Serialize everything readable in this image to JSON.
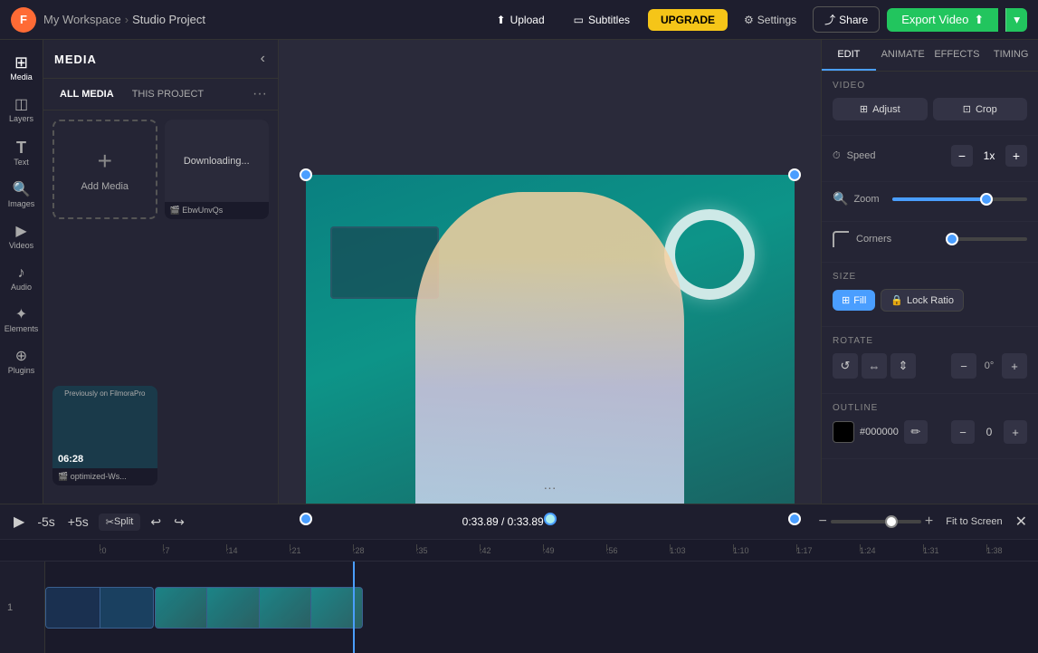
{
  "topbar": {
    "logo_text": "F",
    "workspace": "My Workspace",
    "arrow": "›",
    "project": "Studio Project",
    "upload_label": "Upload",
    "subtitles_label": "Subtitles",
    "upgrade_label": "UPGRADE",
    "settings_label": "Settings",
    "share_label": "Share",
    "export_label": "Export Video",
    "export_arrow": "▾"
  },
  "left_sidebar": {
    "items": [
      {
        "id": "media",
        "icon": "⊞",
        "label": "Media",
        "active": true
      },
      {
        "id": "layers",
        "icon": "◫",
        "label": "Layers"
      },
      {
        "id": "text",
        "icon": "T",
        "label": "Text"
      },
      {
        "id": "images",
        "icon": "🔍",
        "label": "Images"
      },
      {
        "id": "videos",
        "icon": "▶",
        "label": "Videos"
      },
      {
        "id": "audio",
        "icon": "♪",
        "label": "Audio"
      },
      {
        "id": "elements",
        "icon": "✦",
        "label": "Elements"
      },
      {
        "id": "plugins",
        "icon": "⊕",
        "label": "Plugins"
      }
    ]
  },
  "media_panel": {
    "title": "MEDIA",
    "tabs": [
      {
        "id": "all",
        "label": "ALL MEDIA",
        "active": true
      },
      {
        "id": "project",
        "label": "THIS PROJECT"
      }
    ],
    "add_media_label": "Add Media",
    "items": [
      {
        "id": "downloading",
        "name": "EbwUnvQs",
        "status": "Downloading..."
      },
      {
        "id": "video1",
        "name": "optimized-Ws...",
        "duration": "06:28",
        "badge": "Previously on FilmoraPro"
      }
    ]
  },
  "canvas": {
    "time_display": "0:33.89 / 0:33.89"
  },
  "right_panel": {
    "tabs": [
      "EDIT",
      "ANIMATE",
      "EFFECTS",
      "TIMING"
    ],
    "active_tab": "EDIT",
    "video_section": {
      "title": "VIDEO",
      "adjust_label": "Adjust",
      "crop_label": "Crop"
    },
    "speed": {
      "label": "Speed",
      "value": "1x",
      "minus": "−",
      "plus": "+"
    },
    "zoom": {
      "label": "Zoom",
      "value": 70
    },
    "corners": {
      "label": "Corners",
      "value": 0
    },
    "size": {
      "title": "SIZE",
      "fill_label": "Fill",
      "lock_label": "Lock Ratio"
    },
    "rotate": {
      "title": "ROTATE",
      "degree": "0°"
    },
    "outline": {
      "title": "OUTLINE",
      "color": "#000000",
      "hex_label": "#000000",
      "value": "0"
    }
  },
  "timeline": {
    "time": "0:33.89 / 0:33.89",
    "ruler_marks": [
      ":0",
      ":7",
      ":14",
      ":21",
      ":28",
      ":35",
      ":42",
      ":49",
      ":56",
      "1:03",
      "1:10",
      "1:17",
      "1:24",
      "1:31",
      "1:38"
    ],
    "fit_label": "Fit to Screen",
    "track_number": "1",
    "controls": {
      "rewind_label": "-5s",
      "forward_label": "+5s",
      "split_label": "Split",
      "undo_label": "↩",
      "redo_label": "↪"
    }
  },
  "colors": {
    "accent_blue": "#4a9eff",
    "accent_green": "#22c55e",
    "upgrade_yellow": "#f5c518",
    "panel_bg": "#252535",
    "dark_bg": "#1a1a2a"
  }
}
